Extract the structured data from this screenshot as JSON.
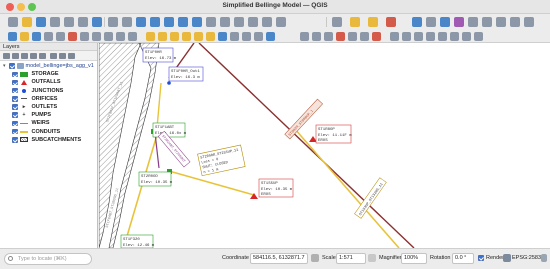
{
  "window": {
    "title": "Simplified Bellinge Model — QGIS"
  },
  "layers_panel": {
    "title": "Layers",
    "group_label": "model_bellinge=jbs_agg_v1",
    "layers": [
      {
        "label": "STORAGE",
        "icon": "storage-square-icon"
      },
      {
        "label": "OUTFALLS",
        "icon": "outfall-triangle-icon"
      },
      {
        "label": "JUNCTIONS",
        "icon": "junction-dot-icon"
      },
      {
        "label": "ORIFICES",
        "icon": "orifice-icon"
      },
      {
        "label": "OUTLETS",
        "icon": "outlet-icon"
      },
      {
        "label": "PUMPS",
        "icon": "pump-icon"
      },
      {
        "label": "WEIRS",
        "icon": "weir-line-icon"
      },
      {
        "label": "CONDUITS",
        "icon": "conduit-line-icon"
      },
      {
        "label": "SUBCATCHMENTS",
        "icon": "subcatchment-polygon-icon"
      }
    ]
  },
  "map": {
    "labels": [
      {
        "text": "ST1F0HR Elev: 16.73 m",
        "color": "#4b4bd6"
      },
      {
        "text": "ST1F0HR_Out1 Elev: 16.3 m",
        "color": "#4b4bd6"
      },
      {
        "text": "ST1F1ABT Elev: 16.0x m",
        "color": "#2aa02a"
      },
      {
        "text": "ST2R0OD Elev: 10.35 m",
        "color": "#2aa02a"
      },
      {
        "text": "ST1F320 Elev: 12.46 m",
        "color": "#2aa02a"
      },
      {
        "text": "ST2R9OR_ST2S5UP_11 Loss = 0 SHUT: CLOSED n = 1 m",
        "color": "#b58b00"
      },
      {
        "text": "ST1S5UP Elev: 10.35 m EROS",
        "color": "#d43c3c"
      },
      {
        "text": "ST1R8OP Elev: 11.11F m EROS",
        "color": "#d43c3c"
      },
      {
        "text": "ST1S3UP_ST1S2NS_11",
        "color": "#b58b00"
      },
      {
        "text": "ST1F0A1F_ST1F0ABT_11",
        "color": "#7f7f7f"
      },
      {
        "text": "ST1F0ABT_ST2R0OD_11",
        "color": "#7f7f7f"
      },
      {
        "text": "ST2R2ABT_ST2S5OUT",
        "color": "#8a3c8a"
      },
      {
        "text": "ST0R2R_ST0R0UP_1",
        "color": "#b54d2d"
      }
    ]
  },
  "status_bar": {
    "search_placeholder": "Type to locate (⌘K)",
    "coordinate_label": "Coordinate",
    "coordinate_value": "584116.5, 6132871.7",
    "scale_label": "Scale",
    "scale_value": "1:571",
    "magnifier_label": "Magnifier",
    "magnifier_value": "100%",
    "rotation_label": "Rotation",
    "rotation_value": "0.0 °",
    "render_label": "Render",
    "crs_label": "EPSG:25832"
  }
}
